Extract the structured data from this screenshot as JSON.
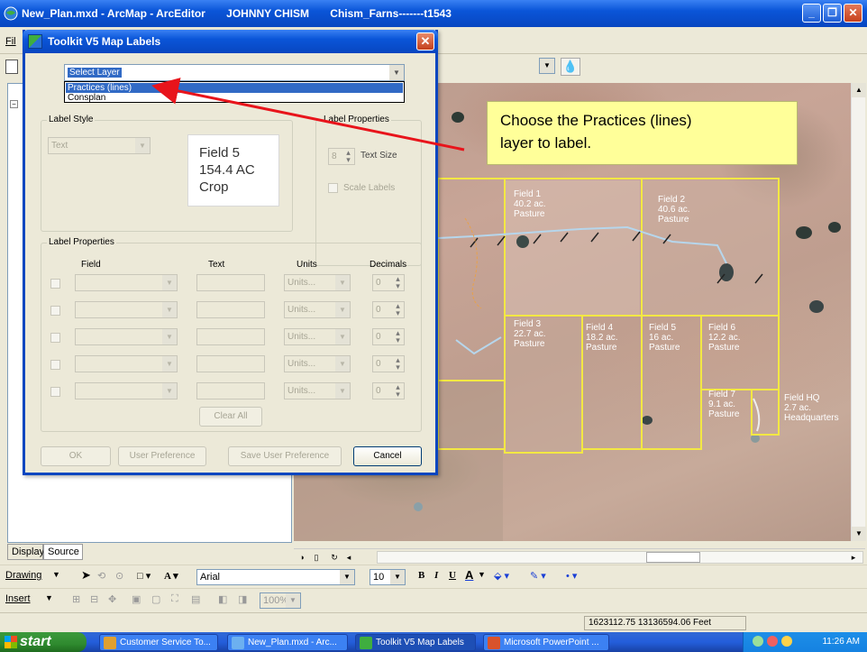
{
  "main_window": {
    "title": "New_Plan.mxd - ArcMap - ArcEditor       JOHNNY CHISM       Chism_Farns-------t1543",
    "minimize": "_",
    "maximize": "❐",
    "close": "✕"
  },
  "menu": {
    "file_stub": "Fil"
  },
  "dialog": {
    "title": "Toolkit V5 Map Labels",
    "close": "✕",
    "layer_select": {
      "value": "Select Layer",
      "options": [
        "Practices (lines)",
        "Consplan"
      ],
      "highlighted": "Practices (lines)"
    },
    "label_style": {
      "heading": "Label Style",
      "style_value": "Text",
      "preview": "Field 5\n154.4 AC\nCrop"
    },
    "label_properties_top": {
      "heading": "Label Properties",
      "text_size_value": "8",
      "text_size_label": "Text Size",
      "scale_labels": "Scale Labels"
    },
    "label_properties": {
      "heading": "Label Properties",
      "columns": {
        "field": "Field",
        "text": "Text",
        "units": "Units",
        "decimals": "Decimals"
      },
      "rows": [
        {
          "units": "Units...",
          "decimals": "0"
        },
        {
          "units": "Units...",
          "decimals": "0"
        },
        {
          "units": "Units...",
          "decimals": "0"
        },
        {
          "units": "Units...",
          "decimals": "0"
        },
        {
          "units": "Units...",
          "decimals": "0"
        }
      ],
      "clear_all": "Clear All"
    },
    "buttons": {
      "ok": "OK",
      "user_preference": "User Preference",
      "save_user_preference": "Save User Preference",
      "cancel": "Cancel"
    }
  },
  "callout": {
    "line1": "Choose the Practices (lines)",
    "line2": "layer to label."
  },
  "map": {
    "fields": [
      {
        "name": "Field 1",
        "acres": "40.2 ac.",
        "use": "Pasture"
      },
      {
        "name": "Field 2",
        "acres": "40.6 ac.",
        "use": "Pasture"
      },
      {
        "name": "Field 3",
        "acres": "22.7 ac.",
        "use": "Pasture"
      },
      {
        "name": "Field 4",
        "acres": "18.2 ac.",
        "use": "Pasture"
      },
      {
        "name": "Field 5",
        "acres": "16 ac.",
        "use": "Pasture"
      },
      {
        "name": "Field 6",
        "acres": "12.2 ac.",
        "use": "Pasture"
      },
      {
        "name": "Field 7",
        "acres": "9.1 ac.",
        "use": "Pasture"
      },
      {
        "name": "Field HQ",
        "acres": "2.7 ac.",
        "use": "Headquarters"
      }
    ]
  },
  "toc": {
    "tabs": [
      "Display",
      "Source"
    ]
  },
  "drawing_toolbar": {
    "drawing_label": "Drawing",
    "font_name": "Arial",
    "font_size": "10",
    "bold": "B",
    "italic": "I",
    "underline": "U",
    "font_color": "A"
  },
  "insert_toolbar": {
    "insert_label": "Insert",
    "zoom": "100%"
  },
  "status": {
    "coordinates": "1623112.75  13136594.06 Feet"
  },
  "taskbar": {
    "start": "start",
    "tasks": [
      "Customer Service To...",
      "New_Plan.mxd - Arc...",
      "Toolkit V5 Map Labels",
      "Microsoft PowerPoint ..."
    ],
    "clock": "11:26 AM"
  }
}
